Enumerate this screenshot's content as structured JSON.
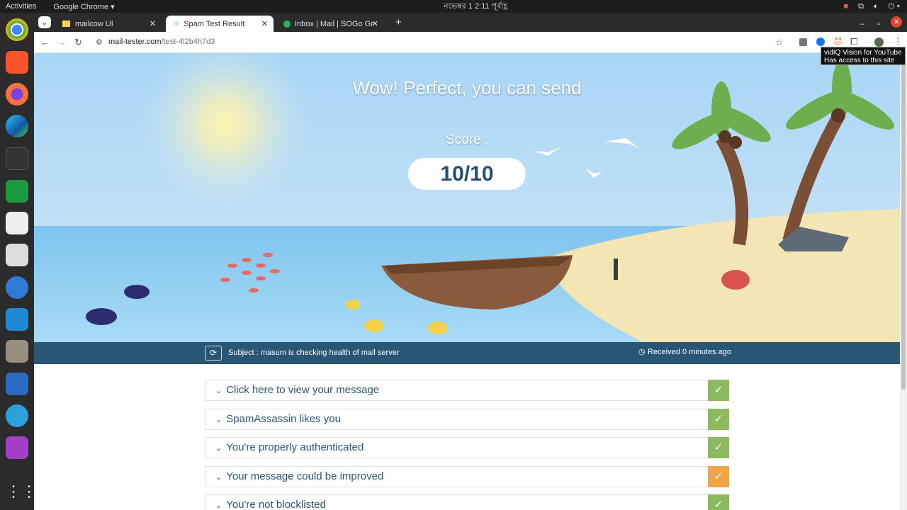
{
  "system": {
    "activities": "Activities",
    "app_name": "Google Chrome ▾",
    "clock": "নভেম্বর 1  2:11 পূর্বাহ্ণ"
  },
  "tabs": [
    {
      "title": "mailcow UI",
      "icon": "mail-icon"
    },
    {
      "title": "Spam Test Result",
      "icon": "snowflake-icon",
      "active": true
    },
    {
      "title": "Inbox | Mail | SOGo Grou",
      "icon": "sogo-icon"
    }
  ],
  "address": {
    "domain": "mail-tester.com",
    "path": "/test-4l2b4h7d3"
  },
  "tooltip": {
    "line1": "vidIQ Vision for YouTube",
    "line2": "Has access to this site"
  },
  "hero": {
    "title": "Wow! Perfect, you can send",
    "score_label": "Score :",
    "score": "10/10"
  },
  "subject_bar": {
    "subject": "Subject : masum is checking health of mail server",
    "received": "Received 0 minutes ago"
  },
  "results": [
    {
      "label": "Click here to view your message",
      "status": "pass",
      "color": "#8cba5c"
    },
    {
      "label": "SpamAssassin likes you",
      "status": "pass",
      "color": "#8cba5c"
    },
    {
      "label": "You're properly authenticated",
      "status": "pass",
      "color": "#8cba5c"
    },
    {
      "label": "Your message could be improved",
      "status": "warning",
      "color": "#f0a54a"
    },
    {
      "label": "You're not blocklisted",
      "status": "pass",
      "color": "#8cba5c"
    }
  ]
}
